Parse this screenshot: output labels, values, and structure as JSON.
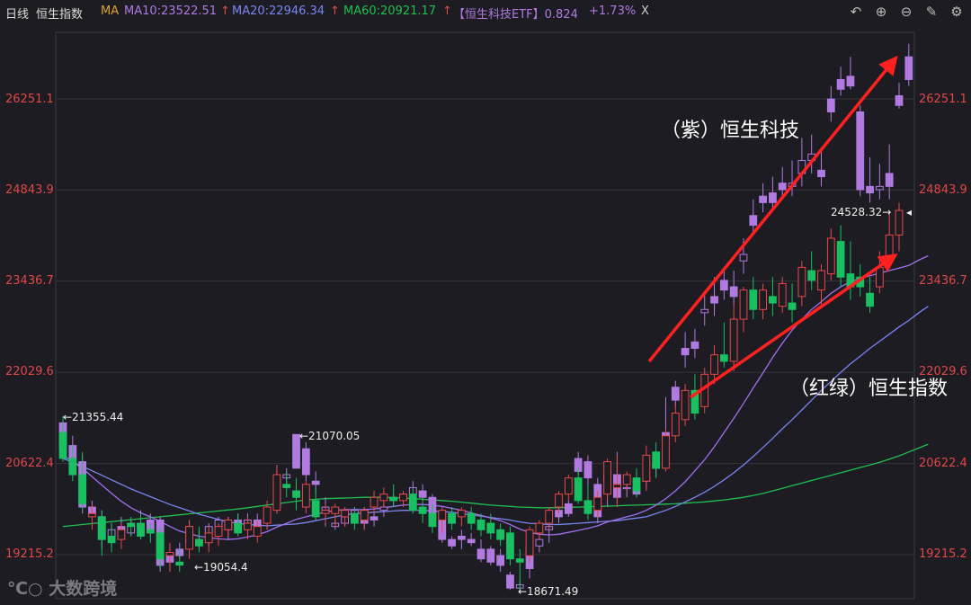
{
  "header": {
    "period": "日线",
    "index_name": "恒生指数",
    "ma_label": "MA",
    "ma10": "MA10:23522.51",
    "ma20": "MA20:22946.34",
    "ma60": "MA60:20921.17",
    "etf": "【恒生科技ETF】0.824",
    "change": "+1.73%",
    "close": "X"
  },
  "toolbar": {
    "undo": "↶",
    "zoom_in": "⊕",
    "zoom_out": "⊖",
    "edit": "✎",
    "settings": "⚙"
  },
  "y_axis": {
    "left": [
      "26251.1",
      "24843.9",
      "23436.7",
      "22029.6",
      "20622.4",
      "19215.2"
    ],
    "right": [
      "26251.1",
      "24843.9",
      "23436.7",
      "22029.6",
      "20622.4",
      "19215.2"
    ]
  },
  "highlow": {
    "h1": "←21355.44",
    "h2": "←21070.05",
    "l1": "←19054.4",
    "l2": "←18671.49",
    "last": "24528.32→"
  },
  "annotations": {
    "purple": "（紫）恒生科技",
    "redgreen": "（红绿）恒生指数"
  },
  "watermark": "大数跨境",
  "colors": {
    "up": "#e84848",
    "down": "#18c062",
    "etf": "#b07ae0",
    "ma10": "#a070ee",
    "ma20": "#7a86f0",
    "ma60": "#20c050",
    "arrow": "#ff2020"
  },
  "chart_data": {
    "type": "candlestick",
    "y_ticks": [
      26251.1,
      24843.9,
      23436.7,
      22029.6,
      20622.4,
      19215.2
    ],
    "ylim": [
      18550,
      27300
    ],
    "hsi": [
      [
        21100,
        21355.44,
        20650,
        20700
      ],
      [
        20700,
        20900,
        20350,
        20450
      ],
      [
        20450,
        20800,
        19900,
        20000
      ],
      [
        19800,
        19980,
        19600,
        19850
      ],
      [
        19800,
        19900,
        19200,
        19450
      ],
      [
        19500,
        19700,
        19250,
        19400
      ],
      [
        19450,
        19700,
        19300,
        19600
      ],
      [
        19700,
        19800,
        19500,
        19650
      ],
      [
        19700,
        19850,
        19450,
        19500
      ],
      [
        19600,
        19700,
        19400,
        19550
      ],
      [
        19550,
        19650,
        19000,
        19150
      ],
      [
        19200,
        19400,
        18950,
        19250
      ],
      [
        19100,
        19300,
        18950,
        19054.4
      ],
      [
        19300,
        19750,
        19150,
        19650
      ],
      [
        19450,
        19650,
        19250,
        19350
      ],
      [
        19400,
        19650,
        19250,
        19550
      ],
      [
        19500,
        19700,
        19350,
        19650
      ],
      [
        19600,
        19800,
        19500,
        19750
      ],
      [
        19700,
        19850,
        19500,
        19550
      ],
      [
        19600,
        19800,
        19450,
        19700
      ],
      [
        19500,
        19750,
        19400,
        19650
      ],
      [
        19700,
        20050,
        19600,
        19950
      ],
      [
        19900,
        20600,
        19850,
        20450
      ],
      [
        20300,
        20500,
        20100,
        20250
      ],
      [
        20200,
        20400,
        19900,
        20100
      ],
      [
        19950,
        20350,
        19850,
        20300
      ],
      [
        20050,
        20250,
        19750,
        19800
      ],
      [
        19850,
        20000,
        19700,
        19900
      ],
      [
        19850,
        20000,
        19650,
        19950
      ],
      [
        19800,
        19950,
        19650,
        19900
      ],
      [
        19850,
        19950,
        19600,
        19700
      ],
      [
        19750,
        19950,
        19600,
        19900
      ],
      [
        19950,
        20200,
        19850,
        20100
      ],
      [
        20050,
        20250,
        19950,
        20150
      ],
      [
        20100,
        20300,
        19950,
        20050
      ],
      [
        20050,
        20200,
        19950,
        20150
      ],
      [
        20150,
        20250,
        19850,
        19900
      ],
      [
        19950,
        20100,
        19700,
        19850
      ],
      [
        19850,
        20000,
        19550,
        19650
      ],
      [
        19750,
        19950,
        19550,
        19900
      ],
      [
        19850,
        19950,
        19600,
        19700
      ],
      [
        19800,
        19950,
        19650,
        19900
      ],
      [
        19850,
        19950,
        19600,
        19700
      ],
      [
        19750,
        19850,
        19500,
        19600
      ],
      [
        19700,
        19850,
        19450,
        19550
      ],
      [
        19600,
        19700,
        19350,
        19450
      ],
      [
        19550,
        19650,
        19050,
        19150
      ],
      [
        19150,
        19300,
        18671.49,
        19100
      ],
      [
        19200,
        19650,
        19100,
        19600
      ],
      [
        19550,
        19750,
        19450,
        19700
      ],
      [
        19700,
        19950,
        19600,
        19900
      ],
      [
        19950,
        20200,
        19850,
        20150
      ],
      [
        20150,
        20450,
        20050,
        20400
      ],
      [
        20400,
        20550,
        20000,
        20050
      ],
      [
        20050,
        20300,
        19750,
        19850
      ],
      [
        19900,
        20200,
        19800,
        20100
      ],
      [
        20150,
        20700,
        20050,
        20650
      ],
      [
        20250,
        20750,
        19950,
        20300
      ],
      [
        20300,
        20500,
        20200,
        20450
      ],
      [
        20400,
        20550,
        20100,
        20200
      ],
      [
        20350,
        20900,
        20200,
        20750
      ],
      [
        20800,
        20950,
        20400,
        20550
      ],
      [
        20550,
        21150,
        20500,
        21050
      ],
      [
        21050,
        21550,
        20950,
        21400
      ],
      [
        21300,
        21850,
        21200,
        21750
      ],
      [
        21750,
        22000,
        21300,
        21400
      ],
      [
        21500,
        22100,
        21400,
        22000
      ],
      [
        22000,
        22450,
        21850,
        22300
      ],
      [
        22300,
        22800,
        22100,
        22200
      ],
      [
        22200,
        23100,
        22050,
        22850
      ],
      [
        22850,
        23350,
        22650,
        23300
      ],
      [
        23300,
        23500,
        22850,
        23000
      ],
      [
        23000,
        23400,
        22850,
        23300
      ],
      [
        23200,
        23500,
        22900,
        23100
      ],
      [
        23050,
        23500,
        22950,
        23400
      ],
      [
        23100,
        23400,
        22800,
        23000
      ],
      [
        23200,
        23750,
        23050,
        23650
      ],
      [
        23600,
        23900,
        23300,
        23450
      ],
      [
        23300,
        23700,
        23050,
        23600
      ],
      [
        23550,
        24250,
        23450,
        24100
      ],
      [
        24050,
        24300,
        23350,
        23500
      ],
      [
        23550,
        24050,
        23150,
        23350
      ],
      [
        23500,
        23700,
        23200,
        23350
      ],
      [
        23250,
        23500,
        22950,
        23050
      ],
      [
        23350,
        23900,
        23250,
        23650
      ],
      [
        23800,
        24500,
        23650,
        24150
      ],
      [
        24150,
        24650,
        23900,
        24528.32
      ]
    ],
    "etf_candles": [
      [
        21250,
        21355.44,
        20800,
        20850
      ],
      [
        20900,
        21050,
        20500,
        20600
      ],
      [
        20650,
        20750,
        19850,
        19950
      ],
      [
        19950,
        20050,
        19750,
        19850
      ],
      [
        19800,
        19900,
        19300,
        19450
      ],
      [
        19500,
        19700,
        19350,
        19600
      ],
      [
        19650,
        19800,
        19450,
        19550
      ],
      [
        19550,
        19750,
        19500,
        19700
      ],
      [
        19700,
        19900,
        19550,
        19650
      ],
      [
        19750,
        19850,
        19500,
        19550
      ],
      [
        19750,
        19800,
        18950,
        19050
      ],
      [
        19200,
        19350,
        18950,
        19100
      ],
      [
        19300,
        19400,
        19150,
        19200
      ],
      [
        19650,
        19750,
        19300,
        19400
      ],
      [
        19400,
        19600,
        19300,
        19450
      ],
      [
        19450,
        19700,
        19350,
        19650
      ],
      [
        19550,
        19800,
        19500,
        19750
      ],
      [
        19600,
        19800,
        19450,
        19700
      ],
      [
        19750,
        19850,
        19550,
        19600
      ],
      [
        19650,
        19850,
        19500,
        19750
      ],
      [
        19750,
        19850,
        19550,
        19650
      ],
      [
        19750,
        19950,
        19600,
        19800
      ],
      [
        19950,
        20600,
        19850,
        20400
      ],
      [
        20400,
        20550,
        20300,
        20450
      ],
      [
        21070.05,
        21070.05,
        20700,
        20550
      ],
      [
        20850,
        20950,
        20350,
        20450
      ],
      [
        20350,
        20500,
        20150,
        20300
      ],
      [
        19900,
        20100,
        19650,
        19950
      ],
      [
        19650,
        19750,
        19600,
        19700
      ],
      [
        19700,
        19850,
        19650,
        19800
      ],
      [
        19850,
        19950,
        19800,
        19900
      ],
      [
        19900,
        19950,
        19600,
        19700
      ],
      [
        19800,
        19900,
        19650,
        19750
      ],
      [
        19900,
        20000,
        19800,
        19950
      ],
      [
        20050,
        20150,
        19950,
        20100
      ],
      [
        20100,
        20200,
        19950,
        20150
      ],
      [
        20150,
        20350,
        20050,
        20250
      ],
      [
        20200,
        20300,
        20050,
        20100
      ],
      [
        20100,
        20150,
        19650,
        19750
      ],
      [
        19850,
        19900,
        19400,
        19450
      ],
      [
        19450,
        19500,
        19300,
        19350
      ],
      [
        19500,
        19600,
        19300,
        19450
      ],
      [
        19450,
        19550,
        19350,
        19400
      ],
      [
        19300,
        19450,
        19100,
        19150
      ],
      [
        19300,
        19350,
        19050,
        19100
      ],
      [
        19200,
        19300,
        18950,
        19050
      ],
      [
        18900,
        18950,
        18671.49,
        18700
      ],
      [
        18700,
        18800,
        18650,
        18750
      ],
      [
        19350,
        19600,
        18850,
        19000
      ],
      [
        19350,
        19500,
        19250,
        19450
      ],
      [
        19600,
        19750,
        19400,
        19650
      ],
      [
        19900,
        20100,
        19700,
        19800
      ],
      [
        20000,
        20050,
        19800,
        19850
      ],
      [
        20700,
        20800,
        20450,
        20500
      ],
      [
        20650,
        20750,
        20250,
        20400
      ],
      [
        20300,
        20400,
        19700,
        19800
      ],
      [
        20350,
        20550,
        19950,
        20450
      ],
      [
        20450,
        20800,
        20000,
        20100
      ],
      [
        20250,
        20350,
        20100,
        20250
      ],
      [
        20250,
        20350,
        20100,
        20150
      ],
      [
        20400,
        20550,
        20250,
        20350
      ],
      [
        20550,
        20700,
        20400,
        20600
      ],
      [
        21100,
        21650,
        20850,
        21000
      ],
      [
        21800,
        21900,
        21500,
        21600
      ],
      [
        22400,
        22650,
        22100,
        22300
      ],
      [
        22500,
        22700,
        22250,
        22400
      ],
      [
        22950,
        23250,
        22750,
        23000
      ],
      [
        23200,
        23500,
        22900,
        23100
      ],
      [
        23450,
        23650,
        23150,
        23300
      ],
      [
        23350,
        23600,
        23050,
        23200
      ],
      [
        23750,
        24100,
        23550,
        23850
      ],
      [
        24450,
        24700,
        24150,
        24300
      ],
      [
        24750,
        24950,
        24500,
        24650
      ],
      [
        24800,
        25050,
        24550,
        24650
      ],
      [
        24950,
        25200,
        24700,
        24850
      ],
      [
        24900,
        25300,
        24750,
        24950
      ],
      [
        25100,
        25650,
        24900,
        25300
      ],
      [
        25300,
        25700,
        25100,
        25400
      ],
      [
        25150,
        25450,
        24900,
        25050
      ],
      [
        26250,
        26450,
        25900,
        26050
      ],
      [
        26550,
        26750,
        26300,
        26400
      ],
      [
        26600,
        26900,
        26400,
        26450
      ],
      [
        26050,
        26150,
        24750,
        24850
      ],
      [
        24900,
        25350,
        24650,
        24800
      ],
      [
        24850,
        25250,
        24700,
        24900
      ],
      [
        25100,
        25550,
        24700,
        24900
      ],
      [
        26300,
        26500,
        26100,
        26150
      ],
      [
        26900,
        27100,
        26450,
        26550
      ]
    ],
    "ma10": [
      20750,
      20650,
      20550,
      20420,
      20290,
      20160,
      20040,
      19940,
      19860,
      19800,
      19730,
      19650,
      19580,
      19540,
      19500,
      19480,
      19460,
      19450,
      19460,
      19490,
      19520,
      19570,
      19640,
      19700,
      19760,
      19800,
      19840,
      19870,
      19900,
      19910,
      19910,
      19910,
      19920,
      19940,
      19960,
      19980,
      19990,
      19990,
      19980,
      19960,
      19930,
      19900,
      19860,
      19820,
      19780,
      19740,
      19680,
      19610,
      19560,
      19530,
      19520,
      19530,
      19560,
      19590,
      19620,
      19660,
      19720,
      19760,
      19800,
      19840,
      19900,
      19980,
      20080,
      20200,
      20340,
      20510,
      20680,
      20880,
      21100,
      21320,
      21550,
      21790,
      22020,
      22260,
      22480,
      22680,
      22850,
      23000,
      23120,
      23250,
      23350,
      23430,
      23480,
      23520,
      23560,
      23600,
      23640,
      23680,
      23760,
      23830
    ],
    "ma20": [
      20700,
      20640,
      20580,
      20510,
      20440,
      20370,
      20300,
      20230,
      20170,
      20110,
      20050,
      19990,
      19940,
      19890,
      19840,
      19800,
      19760,
      19720,
      19700,
      19680,
      19670,
      19660,
      19670,
      19680,
      19690,
      19710,
      19740,
      19770,
      19800,
      19830,
      19850,
      19860,
      19870,
      19880,
      19890,
      19900,
      19900,
      19900,
      19890,
      19880,
      19870,
      19850,
      19830,
      19810,
      19790,
      19770,
      19750,
      19720,
      19700,
      19690,
      19680,
      19680,
      19690,
      19700,
      19710,
      19720,
      19730,
      19740,
      19760,
      19780,
      19800,
      19850,
      19900,
      19960,
      20030,
      20100,
      20180,
      20270,
      20370,
      20480,
      20600,
      20730,
      20870,
      21010,
      21160,
      21300,
      21450,
      21600,
      21750,
      21890,
      22030,
      22160,
      22280,
      22400,
      22510,
      22620,
      22730,
      22830,
      22946,
      23050
    ],
    "ma60": [
      19650,
      19665,
      19680,
      19695,
      19710,
      19725,
      19740,
      19755,
      19770,
      19785,
      19800,
      19815,
      19830,
      19845,
      19860,
      19875,
      19890,
      19905,
      19920,
      19940,
      19960,
      19980,
      20000,
      20020,
      20040,
      20060,
      20070,
      20080,
      20085,
      20090,
      20095,
      20100,
      20100,
      20100,
      20095,
      20090,
      20080,
      20070,
      20060,
      20050,
      20040,
      20025,
      20010,
      19995,
      19980,
      19970,
      19960,
      19950,
      19945,
      19940,
      19940,
      19940,
      19945,
      19950,
      19955,
      19960,
      19965,
      19970,
      19975,
      19980,
      19985,
      19990,
      19995,
      20000,
      20010,
      20020,
      20030,
      20045,
      20060,
      20080,
      20100,
      20130,
      20160,
      20200,
      20240,
      20280,
      20320,
      20360,
      20400,
      20440,
      20480,
      20520,
      20560,
      20600,
      20640,
      20690,
      20740,
      20800,
      20860,
      20921
    ]
  }
}
